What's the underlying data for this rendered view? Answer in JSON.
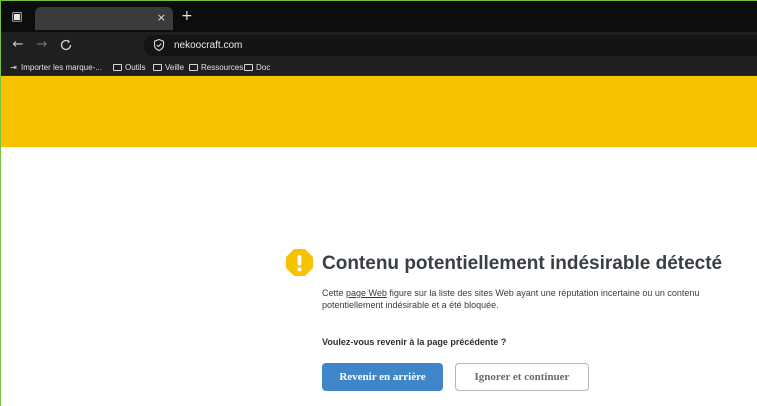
{
  "browser": {
    "tab": {
      "title": "",
      "close_glyph": "×"
    },
    "new_tab_glyph": "+",
    "nav": {
      "back": "←",
      "forward": "→",
      "reload": "C"
    },
    "url": "nekoocraft.com",
    "bookmarks": [
      {
        "label": "Importer les marque-...",
        "icon": "import-icon"
      },
      {
        "label": "Outils",
        "icon": "folder-icon"
      },
      {
        "label": "Veille",
        "icon": "folder-icon"
      },
      {
        "label": "Ressources",
        "icon": "folder-icon"
      },
      {
        "label": "Doc",
        "icon": "folder-icon"
      }
    ]
  },
  "page": {
    "banner_color": "#f7c200",
    "warning_icon": "warning-icon",
    "headline": "Contenu potentiellement indésirable détecté",
    "desc_prefix": "Cette ",
    "desc_link": "page Web",
    "desc_suffix": " figure sur la liste des sites Web ayant une réputation incertaine ou un contenu potentiellement indésirable et a été bloquée.",
    "question": "Voulez-vous revenir à la page précédente ?",
    "primary_button": "Revenir en arrière",
    "secondary_button": "Ignorer et continuer",
    "accent_color": "#3f86c8"
  }
}
